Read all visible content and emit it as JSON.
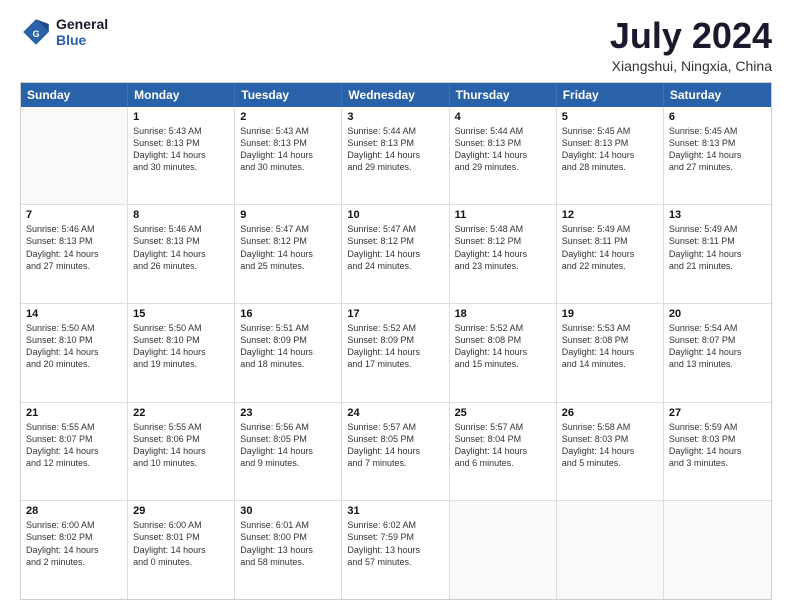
{
  "logo": {
    "line1": "General",
    "line2": "Blue"
  },
  "title": "July 2024",
  "subtitle": "Xiangshui, Ningxia, China",
  "days": [
    "Sunday",
    "Monday",
    "Tuesday",
    "Wednesday",
    "Thursday",
    "Friday",
    "Saturday"
  ],
  "weeks": [
    [
      {
        "num": "",
        "text": ""
      },
      {
        "num": "1",
        "text": "Sunrise: 5:43 AM\nSunset: 8:13 PM\nDaylight: 14 hours\nand 30 minutes."
      },
      {
        "num": "2",
        "text": "Sunrise: 5:43 AM\nSunset: 8:13 PM\nDaylight: 14 hours\nand 30 minutes."
      },
      {
        "num": "3",
        "text": "Sunrise: 5:44 AM\nSunset: 8:13 PM\nDaylight: 14 hours\nand 29 minutes."
      },
      {
        "num": "4",
        "text": "Sunrise: 5:44 AM\nSunset: 8:13 PM\nDaylight: 14 hours\nand 29 minutes."
      },
      {
        "num": "5",
        "text": "Sunrise: 5:45 AM\nSunset: 8:13 PM\nDaylight: 14 hours\nand 28 minutes."
      },
      {
        "num": "6",
        "text": "Sunrise: 5:45 AM\nSunset: 8:13 PM\nDaylight: 14 hours\nand 27 minutes."
      }
    ],
    [
      {
        "num": "7",
        "text": "Sunrise: 5:46 AM\nSunset: 8:13 PM\nDaylight: 14 hours\nand 27 minutes."
      },
      {
        "num": "8",
        "text": "Sunrise: 5:46 AM\nSunset: 8:13 PM\nDaylight: 14 hours\nand 26 minutes."
      },
      {
        "num": "9",
        "text": "Sunrise: 5:47 AM\nSunset: 8:12 PM\nDaylight: 14 hours\nand 25 minutes."
      },
      {
        "num": "10",
        "text": "Sunrise: 5:47 AM\nSunset: 8:12 PM\nDaylight: 14 hours\nand 24 minutes."
      },
      {
        "num": "11",
        "text": "Sunrise: 5:48 AM\nSunset: 8:12 PM\nDaylight: 14 hours\nand 23 minutes."
      },
      {
        "num": "12",
        "text": "Sunrise: 5:49 AM\nSunset: 8:11 PM\nDaylight: 14 hours\nand 22 minutes."
      },
      {
        "num": "13",
        "text": "Sunrise: 5:49 AM\nSunset: 8:11 PM\nDaylight: 14 hours\nand 21 minutes."
      }
    ],
    [
      {
        "num": "14",
        "text": "Sunrise: 5:50 AM\nSunset: 8:10 PM\nDaylight: 14 hours\nand 20 minutes."
      },
      {
        "num": "15",
        "text": "Sunrise: 5:50 AM\nSunset: 8:10 PM\nDaylight: 14 hours\nand 19 minutes."
      },
      {
        "num": "16",
        "text": "Sunrise: 5:51 AM\nSunset: 8:09 PM\nDaylight: 14 hours\nand 18 minutes."
      },
      {
        "num": "17",
        "text": "Sunrise: 5:52 AM\nSunset: 8:09 PM\nDaylight: 14 hours\nand 17 minutes."
      },
      {
        "num": "18",
        "text": "Sunrise: 5:52 AM\nSunset: 8:08 PM\nDaylight: 14 hours\nand 15 minutes."
      },
      {
        "num": "19",
        "text": "Sunrise: 5:53 AM\nSunset: 8:08 PM\nDaylight: 14 hours\nand 14 minutes."
      },
      {
        "num": "20",
        "text": "Sunrise: 5:54 AM\nSunset: 8:07 PM\nDaylight: 14 hours\nand 13 minutes."
      }
    ],
    [
      {
        "num": "21",
        "text": "Sunrise: 5:55 AM\nSunset: 8:07 PM\nDaylight: 14 hours\nand 12 minutes."
      },
      {
        "num": "22",
        "text": "Sunrise: 5:55 AM\nSunset: 8:06 PM\nDaylight: 14 hours\nand 10 minutes."
      },
      {
        "num": "23",
        "text": "Sunrise: 5:56 AM\nSunset: 8:05 PM\nDaylight: 14 hours\nand 9 minutes."
      },
      {
        "num": "24",
        "text": "Sunrise: 5:57 AM\nSunset: 8:05 PM\nDaylight: 14 hours\nand 7 minutes."
      },
      {
        "num": "25",
        "text": "Sunrise: 5:57 AM\nSunset: 8:04 PM\nDaylight: 14 hours\nand 6 minutes."
      },
      {
        "num": "26",
        "text": "Sunrise: 5:58 AM\nSunset: 8:03 PM\nDaylight: 14 hours\nand 5 minutes."
      },
      {
        "num": "27",
        "text": "Sunrise: 5:59 AM\nSunset: 8:03 PM\nDaylight: 14 hours\nand 3 minutes."
      }
    ],
    [
      {
        "num": "28",
        "text": "Sunrise: 6:00 AM\nSunset: 8:02 PM\nDaylight: 14 hours\nand 2 minutes."
      },
      {
        "num": "29",
        "text": "Sunrise: 6:00 AM\nSunset: 8:01 PM\nDaylight: 14 hours\nand 0 minutes."
      },
      {
        "num": "30",
        "text": "Sunrise: 6:01 AM\nSunset: 8:00 PM\nDaylight: 13 hours\nand 58 minutes."
      },
      {
        "num": "31",
        "text": "Sunrise: 6:02 AM\nSunset: 7:59 PM\nDaylight: 13 hours\nand 57 minutes."
      },
      {
        "num": "",
        "text": ""
      },
      {
        "num": "",
        "text": ""
      },
      {
        "num": "",
        "text": ""
      }
    ]
  ]
}
